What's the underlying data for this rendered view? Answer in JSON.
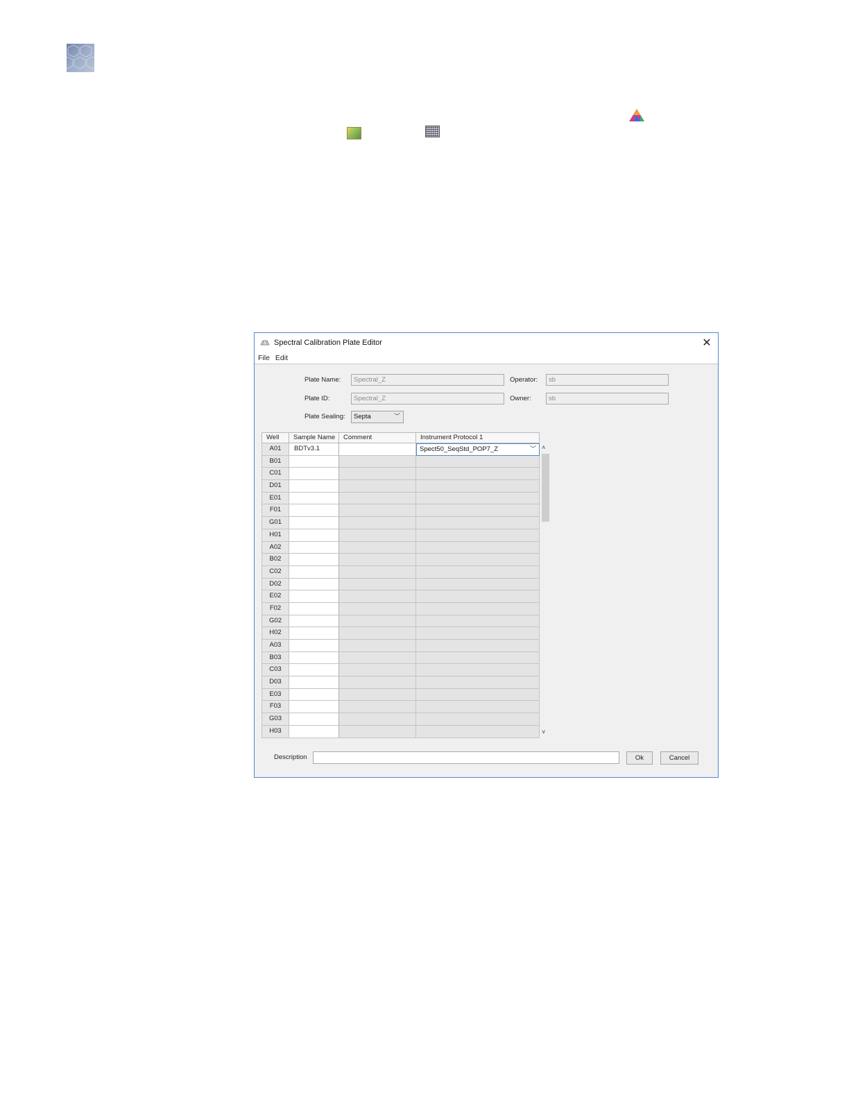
{
  "window": {
    "title": "Spectral Calibration Plate Editor",
    "close_glyph": "✕"
  },
  "menu": [
    "File",
    "Edit"
  ],
  "form": {
    "plate_name": {
      "label": "Plate Name:",
      "value": "Spectral_Z"
    },
    "plate_id": {
      "label": "Plate ID:",
      "value": "Spectral_Z"
    },
    "operator": {
      "label": "Operator:",
      "value": "sb"
    },
    "owner": {
      "label": "Owner:",
      "value": "sb"
    },
    "plate_sealing": {
      "label": "Plate Sealing:",
      "value": "Septa"
    }
  },
  "table": {
    "columns": [
      "Well",
      "Sample Name",
      "Comment",
      "Instrument Protocol 1"
    ],
    "rows": [
      {
        "well": "A01",
        "sample": "BDTv3.1",
        "comment": "",
        "protocol": "Spect50_SeqStd_POP7_Z"
      },
      {
        "well": "B01",
        "sample": "",
        "comment": "",
        "protocol": ""
      },
      {
        "well": "C01",
        "sample": "",
        "comment": "",
        "protocol": ""
      },
      {
        "well": "D01",
        "sample": "",
        "comment": "",
        "protocol": ""
      },
      {
        "well": "E01",
        "sample": "",
        "comment": "",
        "protocol": ""
      },
      {
        "well": "F01",
        "sample": "",
        "comment": "",
        "protocol": ""
      },
      {
        "well": "G01",
        "sample": "",
        "comment": "",
        "protocol": ""
      },
      {
        "well": "H01",
        "sample": "",
        "comment": "",
        "protocol": ""
      },
      {
        "well": "A02",
        "sample": "",
        "comment": "",
        "protocol": ""
      },
      {
        "well": "B02",
        "sample": "",
        "comment": "",
        "protocol": ""
      },
      {
        "well": "C02",
        "sample": "",
        "comment": "",
        "protocol": ""
      },
      {
        "well": "D02",
        "sample": "",
        "comment": "",
        "protocol": ""
      },
      {
        "well": "E02",
        "sample": "",
        "comment": "",
        "protocol": ""
      },
      {
        "well": "F02",
        "sample": "",
        "comment": "",
        "protocol": ""
      },
      {
        "well": "G02",
        "sample": "",
        "comment": "",
        "protocol": ""
      },
      {
        "well": "H02",
        "sample": "",
        "comment": "",
        "protocol": ""
      },
      {
        "well": "A03",
        "sample": "",
        "comment": "",
        "protocol": ""
      },
      {
        "well": "B03",
        "sample": "",
        "comment": "",
        "protocol": ""
      },
      {
        "well": "C03",
        "sample": "",
        "comment": "",
        "protocol": ""
      },
      {
        "well": "D03",
        "sample": "",
        "comment": "",
        "protocol": ""
      },
      {
        "well": "E03",
        "sample": "",
        "comment": "",
        "protocol": ""
      },
      {
        "well": "F03",
        "sample": "",
        "comment": "",
        "protocol": ""
      },
      {
        "well": "G03",
        "sample": "",
        "comment": "",
        "protocol": ""
      },
      {
        "well": "H03",
        "sample": "",
        "comment": "",
        "protocol": ""
      }
    ]
  },
  "footer": {
    "description_label": "Description",
    "description_value": "",
    "ok_label": "Ok",
    "cancel_label": "Cancel"
  },
  "icons": {
    "page_logo": "hexagon-pattern-logo-icon",
    "top_right": "color-triangle-icon",
    "image": "image-thumbnail-icon",
    "plate": "plate-grid-icon",
    "dialog": "plate-editor-icon",
    "dropdown": "chevron-down-icon"
  },
  "colors": {
    "dialog_border": "#4e89c9",
    "dialog_bg": "#f0f0f0",
    "disabled_cell": "#e4e4e4"
  }
}
